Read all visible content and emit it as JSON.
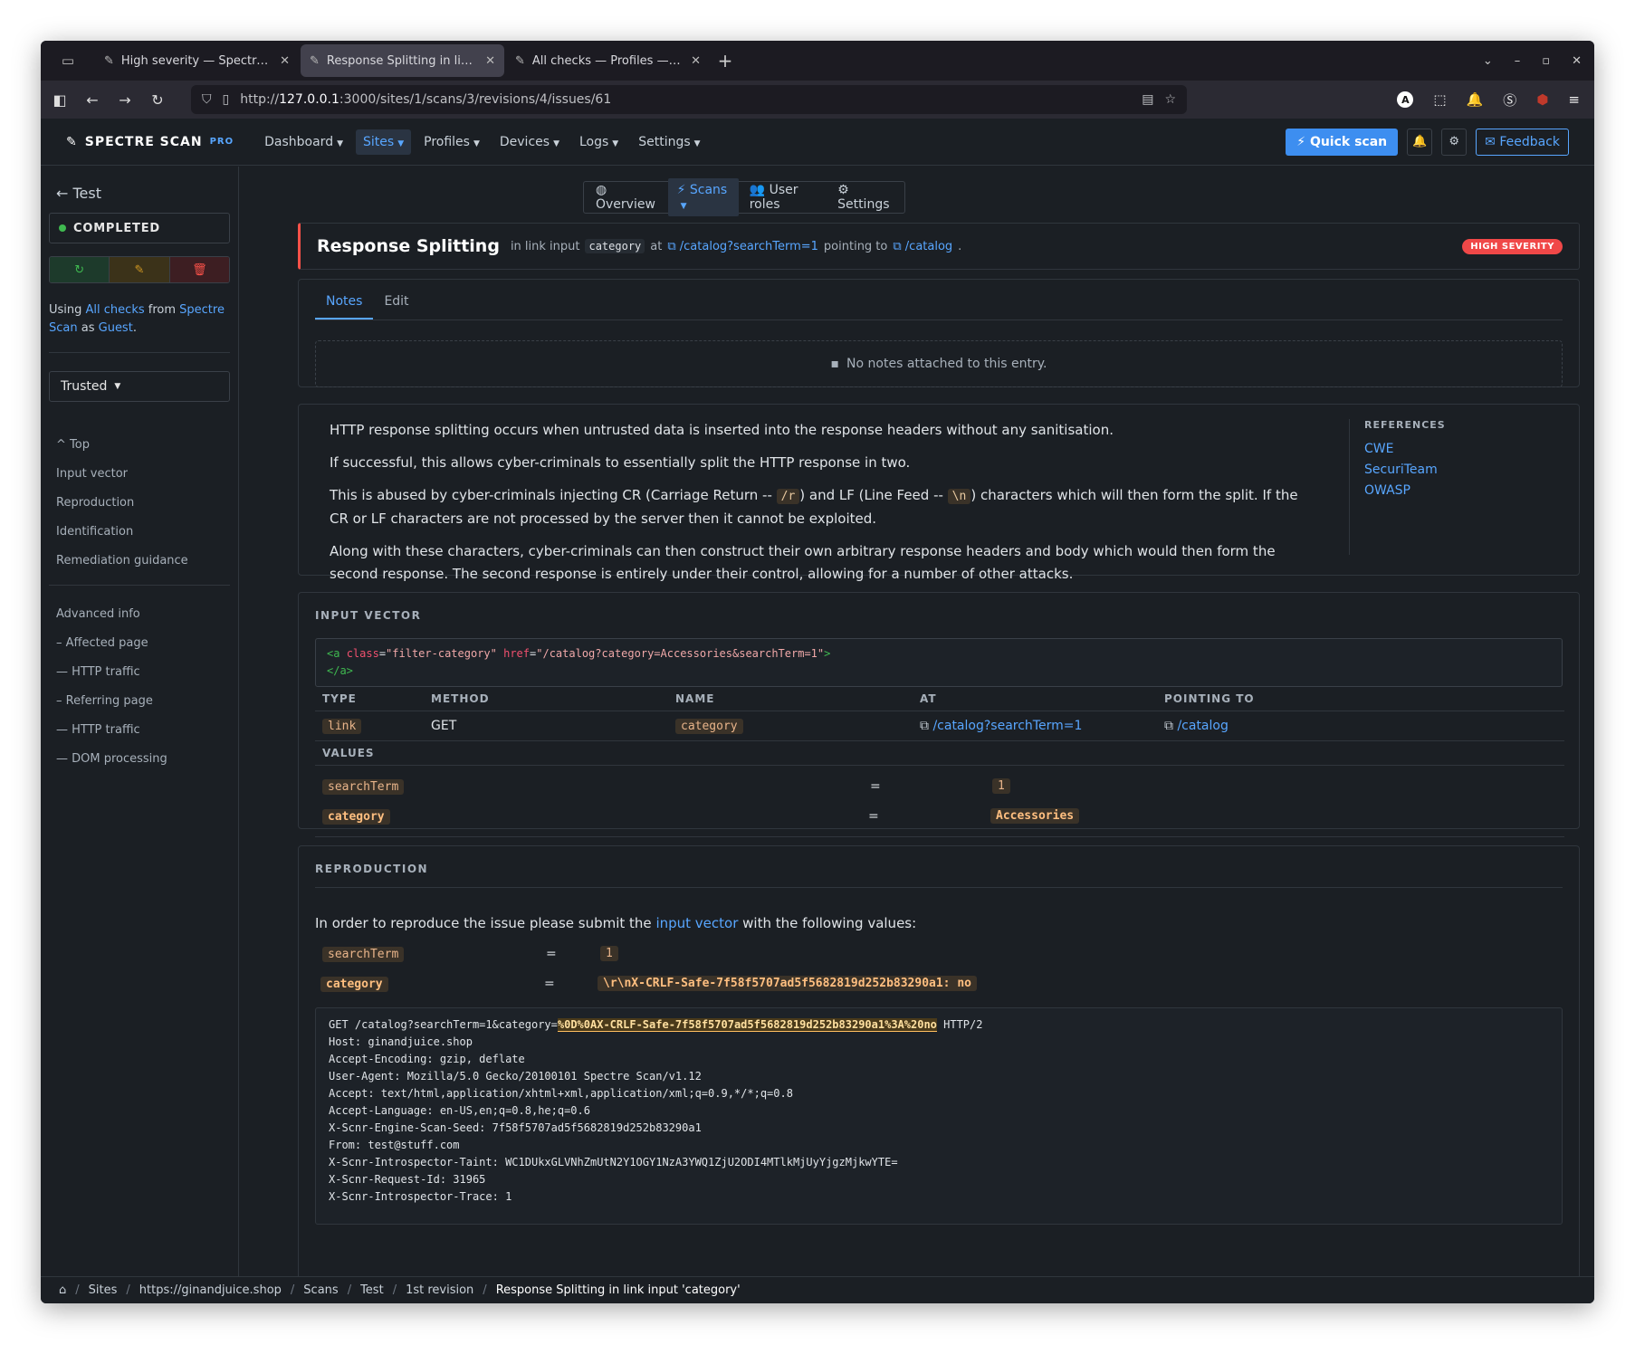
{
  "browser": {
    "tabs": [
      {
        "label": "High severity — Spectre Sc"
      },
      {
        "label": "Response Splitting in link i"
      },
      {
        "label": "All checks — Profiles — Spe"
      }
    ],
    "url_prefix": "http://",
    "url_host": "127.0.0.1",
    "url_rest": ":3000/sites/1/scans/3/revisions/4/issues/61",
    "ext_badge": "A"
  },
  "appnav": {
    "brand": "SPECTRE SCAN",
    "pro": "PRO",
    "items": [
      "Dashboard",
      "Sites",
      "Profiles",
      "Devices",
      "Logs",
      "Settings"
    ],
    "quick_scan": "Quick scan",
    "feedback": "Feedback"
  },
  "sidebar": {
    "back": "Test",
    "status": "COMPLETED",
    "using_prefix": "Using ",
    "using_profile": "All checks",
    "using_from": " from ",
    "using_site": "Spectre Scan",
    "using_as": " as ",
    "using_user": "Guest",
    "using_end": ".",
    "trusted": "Trusted",
    "toc": [
      "Top",
      "Input vector",
      "Reproduction",
      "Identification",
      "Remediation guidance"
    ],
    "toc_adv": [
      "Advanced info",
      "– Affected page",
      "— HTTP traffic",
      "– Referring page",
      "— HTTP traffic",
      "— DOM processing"
    ]
  },
  "subnav": [
    "Overview",
    "Scans",
    "User roles",
    "Settings"
  ],
  "issue": {
    "title": "Response Splitting",
    "in_text": "in link input",
    "input_name": "category",
    "at_text": "at",
    "at_link": "/catalog?searchTerm=1",
    "pointing_text": "pointing to",
    "pointing_link": "/catalog",
    "end": ".",
    "severity": "HIGH SEVERITY"
  },
  "notes": {
    "tabs": [
      "Notes",
      "Edit"
    ],
    "empty": "No notes attached to this entry."
  },
  "description": {
    "p1": "HTTP response splitting occurs when untrusted data is inserted into the response headers without any sanitisation.",
    "p2": "If successful, this allows cyber-criminals to essentially split the HTTP response in two.",
    "p3a": "This is abused by cyber-criminals injecting CR (Carriage Return -- ",
    "p3cr": "/r",
    "p3b": ") and LF (Line Feed -- ",
    "p3lf": "\\n",
    "p3c": ") characters which will then form the split. If the CR or LF characters are not processed by the server then it cannot be exploited.",
    "p4": "Along with these characters, cyber-criminals can then construct their own arbitrary response headers and body which would then form the second response. The second response is entirely under their control, allowing for a number of other attacks.",
    "refs_title": "REFERENCES",
    "refs": [
      "CWE",
      "SecuriTeam",
      "OWASP"
    ]
  },
  "input_vector": {
    "title": "INPUT VECTOR",
    "code_open": "<a",
    "code_attr1": "class",
    "code_val1": "\"filter-category\"",
    "code_attr2": "href",
    "code_val2": "\"/catalog?category=Accessories&searchTerm=1\"",
    "code_gt": ">",
    "code_close": "</a>",
    "headers": [
      "TYPE",
      "METHOD",
      "NAME",
      "AT",
      "POINTING TO"
    ],
    "type": "link",
    "method": "GET",
    "name": "category",
    "at": "/catalog?searchTerm=1",
    "pointing": "/catalog",
    "values_title": "VALUES",
    "values": [
      {
        "name": "searchTerm",
        "eq": "=",
        "value": "1"
      },
      {
        "name": "category",
        "eq": "=",
        "value": "Accessories"
      }
    ]
  },
  "reproduction": {
    "title": "REPRODUCTION",
    "intro_a": "In order to reproduce the issue please submit the ",
    "intro_link": "input vector",
    "intro_b": " with the following values:",
    "values": [
      {
        "name": "searchTerm",
        "eq": "=",
        "value": "1"
      },
      {
        "name": "category",
        "eq": "=",
        "value": "\\r\\nX-CRLF-Safe-7f58f5707ad5f5682819d252b83290a1: no"
      }
    ],
    "req_line_a": "GET /catalog?searchTerm=1&category=",
    "req_line_hl": "%0D%0AX-CRLF-Safe-7f58f5707ad5f5682819d252b83290a1%3A%20no",
    "req_line_b": " HTTP/2",
    "headers": "Host: ginandjuice.shop\nAccept-Encoding: gzip, deflate\nUser-Agent: Mozilla/5.0 Gecko/20100101 Spectre Scan/v1.12\nAccept: text/html,application/xhtml+xml,application/xml;q=0.9,*/*;q=0.8\nAccept-Language: en-US,en;q=0.8,he;q=0.6\nX-Scnr-Engine-Scan-Seed: 7f58f5707ad5f5682819d252b83290a1\nFrom: test@stuff.com\nX-Scnr-Introspector-Taint: WC1DUkxGLVNhZmUtN2Y1OGY1NzA3YWQ1ZjU2ODI4MTlkMjUyYjgzMjkwYTE=\nX-Scnr-Request-Id: 31965\nX-Scnr-Introspector-Trace: 1"
  },
  "breadcrumb": [
    "Sites",
    "https://ginandjuice.shop",
    "Scans",
    "Test",
    "1st revision",
    "Response Splitting in link input 'category'"
  ]
}
